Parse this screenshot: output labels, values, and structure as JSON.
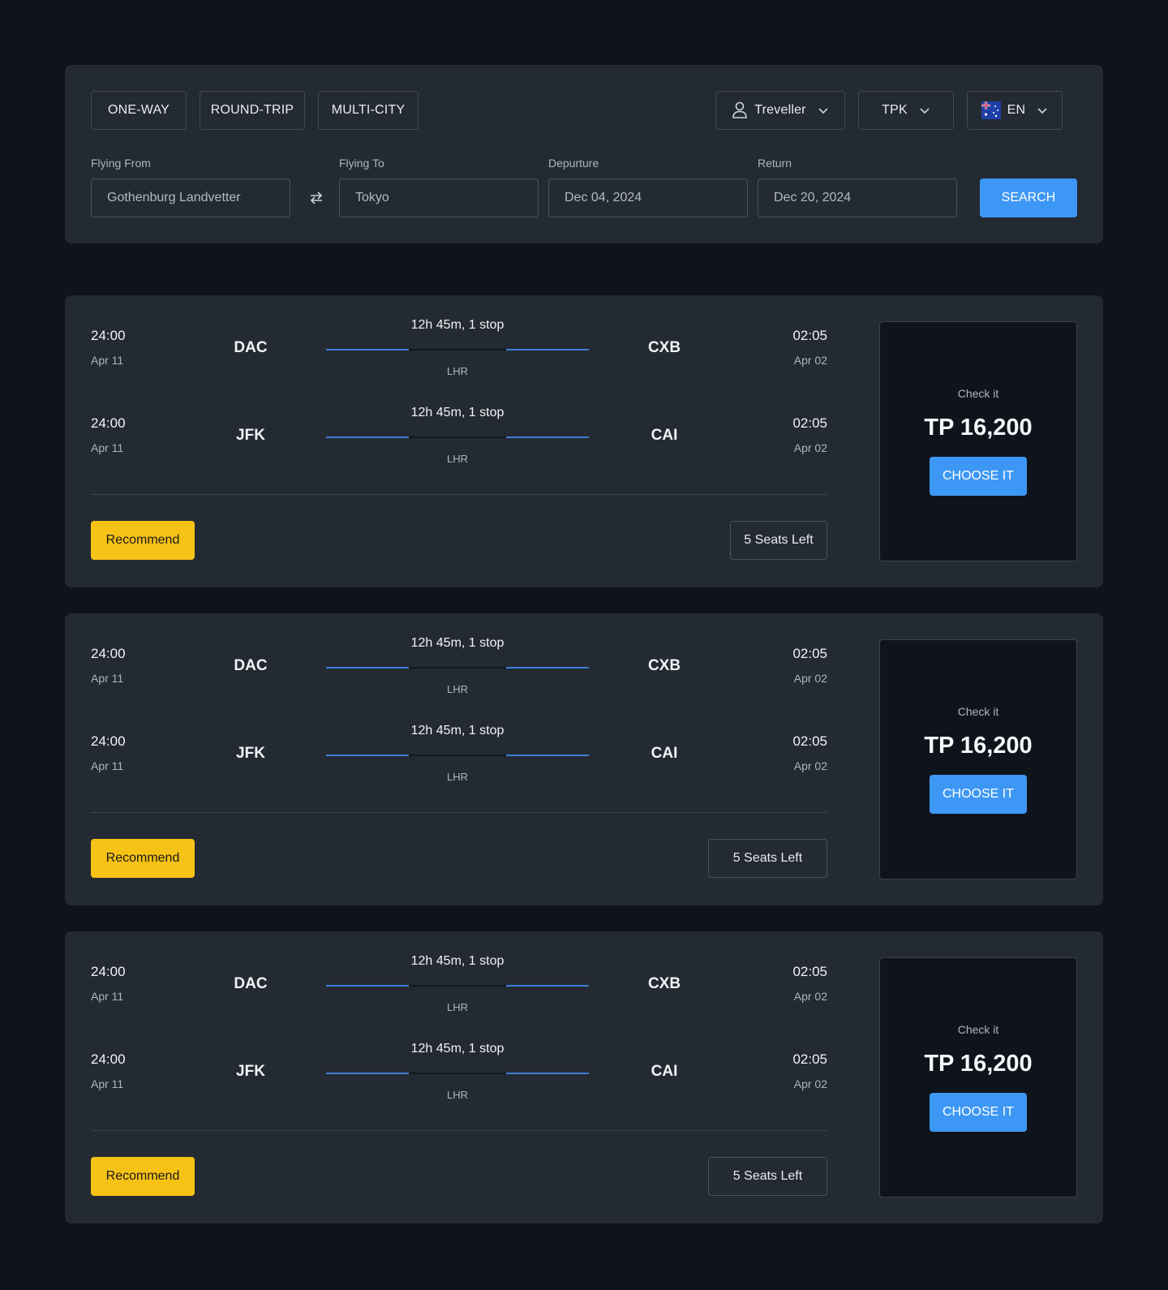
{
  "trip_types": [
    "ONE-WAY",
    "ROUND-TRIP",
    "MULTI-CITY"
  ],
  "traveller_label": "Treveller",
  "currency_label": "TPK",
  "language_label": "EN",
  "form": {
    "from_label": "Flying From",
    "from_value": "Gothenburg Landvetter",
    "to_label": "Flying To",
    "to_value": "Tokyo",
    "departure_label": "Depurture",
    "departure_value": "Dec 04, 2024",
    "return_label": "Return",
    "return_value": "Dec 20, 2024",
    "search_label": "SEARCH"
  },
  "results": [
    {
      "legs": [
        {
          "dep_time": "24:00",
          "dep_date": "Apr 11",
          "from": "DAC",
          "duration": "12h 45m, 1 stop",
          "via": "LHR",
          "to": "CXB",
          "arr_time": "02:05",
          "arr_date": "Apr 02"
        },
        {
          "dep_time": "24:00",
          "dep_date": "Apr 11",
          "from": "JFK",
          "duration": "12h 45m, 1 stop",
          "via": "LHR",
          "to": "CAI",
          "arr_time": "02:05",
          "arr_date": "Apr 02"
        }
      ],
      "badge": "Recommend",
      "seats": "5 Seats Left",
      "check_label": "Check it",
      "price": "TP 16,200",
      "choose_label": "CHOOSE IT"
    },
    {
      "legs": [
        {
          "dep_time": "24:00",
          "dep_date": "Apr 11",
          "from": "DAC",
          "duration": "12h 45m, 1 stop",
          "via": "LHR",
          "to": "CXB",
          "arr_time": "02:05",
          "arr_date": "Apr 02"
        },
        {
          "dep_time": "24:00",
          "dep_date": "Apr 11",
          "from": "JFK",
          "duration": "12h 45m, 1 stop",
          "via": "LHR",
          "to": "CAI",
          "arr_time": "02:05",
          "arr_date": "Apr 02"
        }
      ],
      "badge": "Recommend",
      "seats": "5 Seats Left",
      "check_label": "Check it",
      "price": "TP 16,200",
      "choose_label": "CHOOSE IT"
    },
    {
      "legs": [
        {
          "dep_time": "24:00",
          "dep_date": "Apr 11",
          "from": "DAC",
          "duration": "12h 45m, 1 stop",
          "via": "LHR",
          "to": "CXB",
          "arr_time": "02:05",
          "arr_date": "Apr 02"
        },
        {
          "dep_time": "24:00",
          "dep_date": "Apr 11",
          "from": "JFK",
          "duration": "12h 45m, 1 stop",
          "via": "LHR",
          "to": "CAI",
          "arr_time": "02:05",
          "arr_date": "Apr 02"
        }
      ],
      "badge": "Recommend",
      "seats": "5 Seats Left",
      "check_label": "Check it",
      "price": "TP 16,200",
      "choose_label": "CHOOSE IT"
    }
  ],
  "colors": {
    "accent": "#3d97f5",
    "badge": "#f6c216",
    "background": "#0f141c",
    "panel": "#242a32"
  }
}
